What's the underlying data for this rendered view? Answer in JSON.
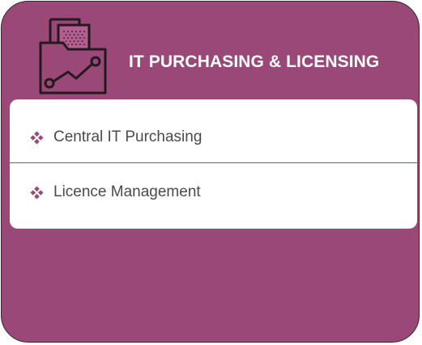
{
  "header": {
    "title": "IT PURCHASING & LICENSING",
    "icon": "folder-chart-icon"
  },
  "list": {
    "items": [
      {
        "label": "Central IT Purchasing",
        "icon": "diamond-bullet-icon"
      },
      {
        "label": "Licence Management",
        "icon": "diamond-bullet-icon"
      }
    ]
  },
  "colors": {
    "card_background": "#994877",
    "bullet": "#994877",
    "panel": "#ffffff",
    "text": "#4a4a4a"
  }
}
